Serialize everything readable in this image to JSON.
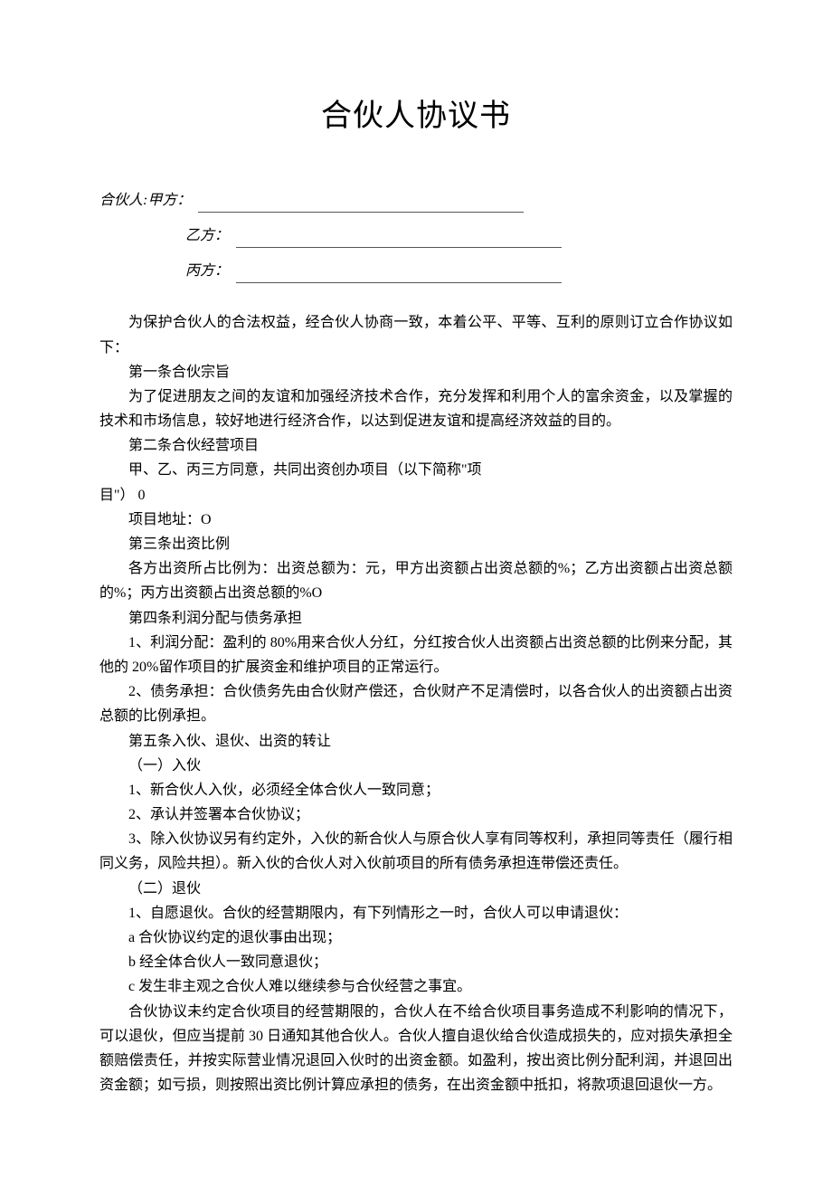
{
  "title": "合伙人协议书",
  "parties": {
    "lead": "合伙人:",
    "a": "甲方：",
    "b": "乙方：",
    "c": "丙方："
  },
  "intro": "为保护合伙人的合法权益，经合伙人协商一致，本着公平、平等、互利的原则订立合作协议如下：",
  "art1": {
    "heading": "第一条合伙宗旨",
    "body": "为了促进朋友之间的友谊和加强经济技术合作，充分发挥和利用个人的富余资金，以及掌握的技术和市场信息，较好地进行经济合作，以达到促进友谊和提高经济效益的目的。"
  },
  "art2": {
    "heading": "第二条合伙经营项目",
    "line1": "甲、乙、丙三方同意，共同出资创办项目（以下简称\"项",
    "line2": "目\"） 0",
    "addr": "项目地址：O"
  },
  "art3": {
    "heading": "第三条出资比例",
    "body": "各方出资所占比例为：出资总额为：元，甲方出资额占出资总额的%；乙方出资额占出资总额的%；丙方出资额占出资总额的%O"
  },
  "art4": {
    "heading": "第四条利润分配与债务承担",
    "p1": "1、利润分配：盈利的 80%用来合伙人分红，分红按合伙人出资额占出资总额的比例来分配，其他的 20%留作项目的扩展资金和维护项目的正常运行。",
    "p2": "2、债务承担：合伙债务先由合伙财产偿还，合伙财产不足清偿时，以各合伙人的出资额占出资总额的比例承担。"
  },
  "art5": {
    "heading": "第五条入伙、退伙、出资的转让",
    "s1": {
      "title": "（一）入伙",
      "p1": "1、新合伙人入伙，必须经全体合伙人一致同意；",
      "p2": "2、承认并签署本合伙协议；",
      "p3": "3、除入伙协议另有约定外，入伙的新合伙人与原合伙人享有同等权利，承担同等责任（履行相同义务，风险共担）。新入伙的合伙人对入伙前项目的所有债务承担连带偿还责任。"
    },
    "s2": {
      "title": "（二）退伙",
      "p1": "1、自愿退伙。合伙的经营期限内，有下列情形之一时，合伙人可以申请退伙：",
      "a": "a 合伙协议约定的退伙事由出现；",
      "b": "b 经全体合伙人一致同意退伙；",
      "c": "c 发生非主观之合伙人难以继续参与合伙经营之事宜。",
      "para": "合伙协议未约定合伙项目的经营期限的，合伙人在不给合伙项目事务造成不利影响的情况下，可以退伙，但应当提前 30 日通知其他合伙人。合伙人擅自退伙给合伙造成损失的，应对损失承担全额赔偿责任，并按实际营业情况退回入伙时的出资金额。如盈利，按出资比例分配利润，并退回出资金额；如亏损，则按照出资比例计算应承担的债务，在出资金额中抵扣，将款项退回退伙一方。"
    }
  }
}
